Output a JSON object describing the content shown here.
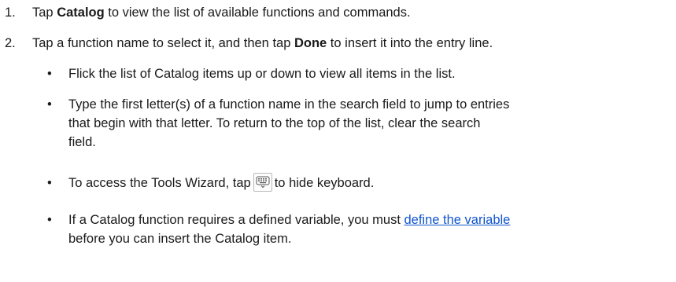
{
  "steps": [
    {
      "number": "1.",
      "pre": "Tap ",
      "bold": "Catalog",
      "post": " to view the list of available functions and commands."
    },
    {
      "number": "2.",
      "pre": "Tap a function name to select it, and then tap ",
      "bold": "Done",
      "post": " to insert it into the entry line."
    }
  ],
  "bullets": {
    "symbol": "•",
    "flick": "Flick the list of Catalog items up or down to view all items in the list.",
    "type_line1": "Type the first letter(s) of a function name in the search field to jump to entries",
    "type_line2": "that begin with that letter. To return to the top of the list, clear the search",
    "type_line3": "field.",
    "tools_pre": "To access the Tools Wizard, tap",
    "tools_icon": "keyboard-hide-icon",
    "tools_post": "to hide keyboard.",
    "catalog_pre": "If a Catalog function requires a defined variable, you must ",
    "catalog_link": "define the variable",
    "catalog_post": "before you can insert the Catalog item."
  },
  "colors": {
    "text": "#1a1a1a",
    "link": "#1155cc"
  }
}
